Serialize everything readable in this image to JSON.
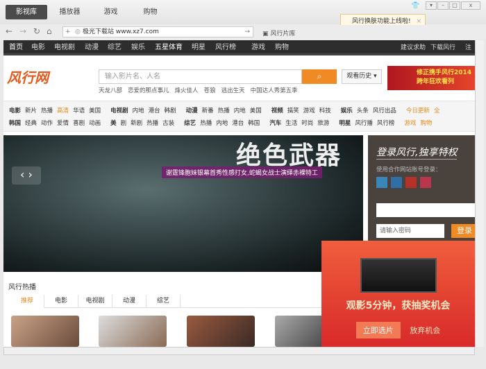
{
  "top_tabs": [
    "影视库",
    "播放器",
    "游戏",
    "购物"
  ],
  "tooltip": {
    "text": "风行换肤功能上线啦!",
    "close": "×"
  },
  "address": {
    "url": "极光下载站 www.xz7.com",
    "library": "风行片库"
  },
  "nav": {
    "items": [
      "首页",
      "电影",
      "电视剧",
      "动漫",
      "综艺",
      "娱乐",
      "五星体育",
      "明星",
      "风行榜",
      "游戏",
      "购物"
    ],
    "right": [
      "建议求助",
      "下载风行",
      "注册"
    ]
  },
  "header": {
    "logo": "风行网",
    "search_placeholder": "输入影片名、人名",
    "history": "观看历史",
    "banner": [
      "修正携手风行2014",
      "跨年狂欢看列"
    ],
    "hot_words": [
      "天龙八部",
      "恋爱的那点事儿",
      "烽火佳人",
      "苍狼",
      "逃出生天",
      "中国达人秀第五季"
    ]
  },
  "categories": {
    "row1": [
      [
        "电影",
        "新片",
        "热播",
        "高清",
        "华语",
        "美国"
      ],
      [
        "电视剧",
        "内地",
        "港台",
        "韩剧"
      ],
      [
        "动漫",
        "新番",
        "热播",
        "内地",
        "美国"
      ],
      [
        "视频",
        "搞笑",
        "游戏",
        "科技"
      ],
      [
        "娱乐",
        "头条",
        "风行出品"
      ],
      [
        "今日更新",
        "全"
      ]
    ],
    "row2": [
      [
        "韩国",
        "经典",
        "动作",
        "爱情",
        "喜剧",
        "动画"
      ],
      [
        "美",
        "剧",
        "新剧",
        "热播",
        "古装"
      ],
      [
        "综艺",
        "热播",
        "内地",
        "港台",
        "韩国"
      ],
      [
        "汽车",
        "生活",
        "时尚",
        "旅游"
      ],
      [
        "明星",
        "风行播",
        "风行榜"
      ],
      [
        "游戏",
        "购物"
      ]
    ]
  },
  "hero": {
    "title": "绝色武器",
    "caption": "谢霆锋胞妹银幕首秀性感打女,蛇蝎女战士演绎赤裸特工",
    "prev": "‹",
    "next": "›"
  },
  "login": {
    "title": "登录风行,独享特权",
    "subtitle": "使用合作网站账号登录：",
    "password_placeholder": "请输入密码",
    "button": "登录"
  },
  "section": {
    "title": "风行热播",
    "tabs": [
      "推荐",
      "电影",
      "电视剧",
      "动漫",
      "综艺"
    ]
  },
  "popup": {
    "title": "观影5分钟，获抽奖机会",
    "primary": "立即选片",
    "secondary": "放弃机会"
  },
  "colors": {
    "accent": "#f08a25",
    "nav": "#2d2d2d",
    "login_bg": "#4a423c"
  }
}
